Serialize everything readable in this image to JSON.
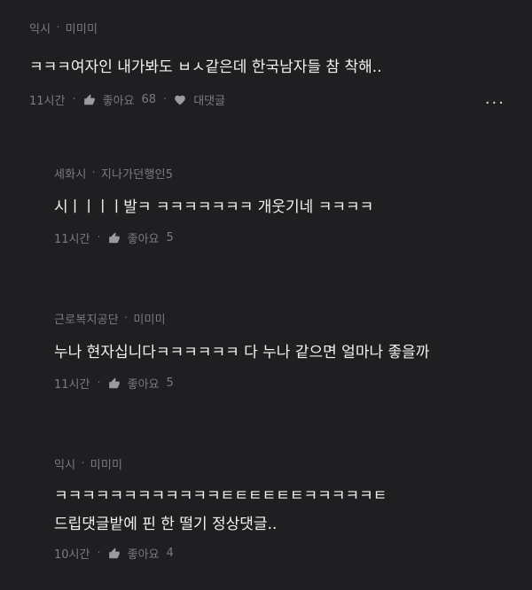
{
  "comments": [
    {
      "author": "익시",
      "user": "미미미",
      "text": "ㅋㅋㅋ여자인 내가봐도 ㅂㅅ같은데 한국남자들 참 착해..",
      "time": "11시간",
      "like_label": "좋아요",
      "likes": "68",
      "reply_label": "대댓글"
    },
    {
      "author": "세화시",
      "user": "지나가던행인5",
      "text": "시ㅣㅣㅣㅣ발ㅋ ㅋㅋㅋㅋㅋㅋㅋ 개웃기네 ㅋㅋㅋㅋ",
      "time": "11시간",
      "like_label": "좋아요",
      "likes": "5"
    },
    {
      "author": "근로복지공단",
      "user": "미미미",
      "text": "누나 현자십니다ㅋㅋㅋㅋㅋㅋ 다 누나 같으면 얼마나 좋을까",
      "time": "11시간",
      "like_label": "좋아요",
      "likes": "5"
    },
    {
      "author": "익시",
      "user": "미미미",
      "text": "ㅋㅋㅋㅋㅋㅋㅋㅋㅋㅋㅋㅋㅌㅌㅌㅌㅌㅌㅋㅋㅋㅋㅋㅌ",
      "text2": "드립댓글밭에 핀 한 떨기 정상댓글..",
      "time": "10시간",
      "like_label": "좋아요",
      "likes": "4"
    }
  ],
  "more_label": "···"
}
